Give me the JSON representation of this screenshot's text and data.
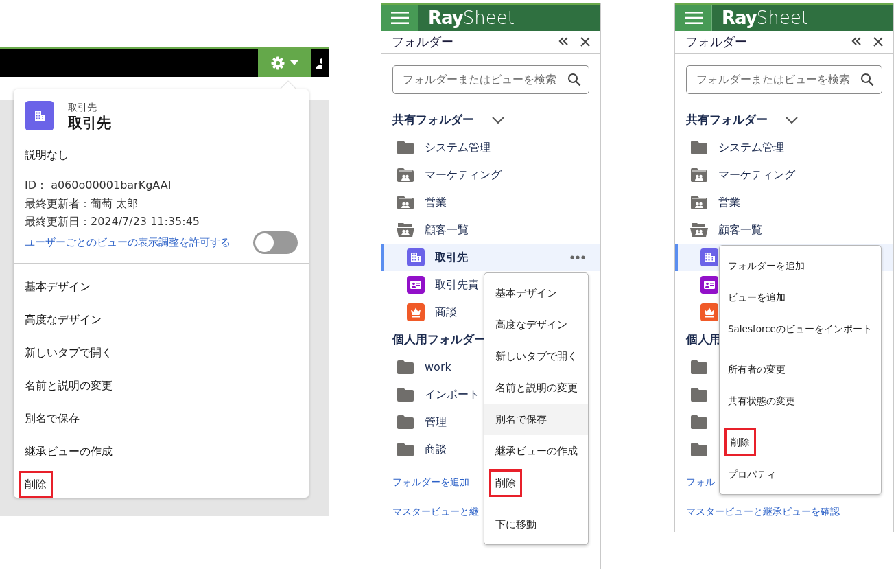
{
  "panel_1": {
    "popover": {
      "object_type": "取引先",
      "title": "取引先",
      "description": "説明なし",
      "details": [
        "ID： a060o00001barKgAAI",
        "最終更新者：葡萄 太郎",
        "最終更新日：2024/7/23 11:35:45"
      ],
      "toggle": {
        "label": "ユーザーごとのビューの表示調整を許可する",
        "on": false
      },
      "menu": [
        [
          {
            "label": "基本デザイン",
            "highlighted": false,
            "hovered": false
          },
          {
            "label": "高度なデザイン",
            "highlighted": false,
            "hovered": false
          },
          {
            "label": "新しいタブで開く",
            "highlighted": false,
            "hovered": false
          },
          {
            "label": "名前と説明の変更",
            "highlighted": false,
            "hovered": false
          },
          {
            "label": "別名で保存",
            "highlighted": false,
            "hovered": false
          },
          {
            "label": "継承ビューの作成",
            "highlighted": false,
            "hovered": false
          },
          {
            "label": "削除",
            "highlighted": true,
            "hovered": false
          }
        ]
      ]
    }
  },
  "panel_2": {
    "logo": {
      "bold": "Ray",
      "light": "Sheet"
    },
    "title": "フォルダー",
    "search": {
      "placeholder": "フォルダーまたはビューを検索"
    },
    "sections": [
      {
        "title": "共有フォルダー",
        "expanded": true,
        "items": [
          {
            "label": "システム管理",
            "kind": "folder",
            "selected": false
          },
          {
            "label": "マーケティング",
            "kind": "shared",
            "selected": false
          },
          {
            "label": "営業",
            "kind": "shared",
            "selected": false
          },
          {
            "label": "顧客一覧",
            "kind": "shared-open",
            "selected": false,
            "children": [
              {
                "label": "取引先",
                "kind": "account",
                "selected": true
              },
              {
                "label": "取引先責",
                "kind": "contact",
                "selected": false
              },
              {
                "label": "商談",
                "kind": "opportunity",
                "selected": false
              }
            ]
          }
        ]
      },
      {
        "title": "個人用フォルダー",
        "items": [
          {
            "label": "work",
            "kind": "folder",
            "selected": false
          },
          {
            "label": "インポート",
            "kind": "folder",
            "selected": false
          },
          {
            "label": "管理",
            "kind": "folder",
            "selected": false
          },
          {
            "label": "商談",
            "kind": "folder",
            "selected": false
          }
        ]
      }
    ],
    "links": [
      "フォルダーを追加",
      "マスタービューと継"
    ],
    "menu": [
      [
        {
          "label": "基本デザイン",
          "highlighted": false,
          "hovered": false
        },
        {
          "label": "高度なデザイン",
          "highlighted": false,
          "hovered": false
        },
        {
          "label": "新しいタブで開く",
          "highlighted": false,
          "hovered": false
        },
        {
          "label": "名前と説明の変更",
          "highlighted": false,
          "hovered": false
        },
        {
          "label": "別名で保存",
          "highlighted": false,
          "hovered": true
        },
        {
          "label": "継承ビューの作成",
          "highlighted": false,
          "hovered": false
        },
        {
          "label": "削除",
          "highlighted": true,
          "hovered": false
        }
      ],
      [
        {
          "label": "下に移動",
          "highlighted": false,
          "hovered": false
        }
      ]
    ]
  },
  "panel_3": {
    "logo": {
      "bold": "Ray",
      "light": "Sheet"
    },
    "title": "フォルダー",
    "search": {
      "placeholder": "フォルダーまたはビューを検索"
    },
    "sections": [
      {
        "title": "共有フォルダー",
        "expanded": true,
        "items": [
          {
            "label": "システム管理",
            "kind": "folder",
            "selected": false
          },
          {
            "label": "マーケティング",
            "kind": "shared",
            "selected": false
          },
          {
            "label": "営業",
            "kind": "shared",
            "selected": false
          },
          {
            "label": "顧客一覧",
            "kind": "shared-open",
            "selected": false,
            "children": [
              {
                "kind": "account",
                "selected": true
              },
              {
                "kind": "contact",
                "selected": false
              },
              {
                "kind": "opportunity",
                "selected": false
              }
            ]
          }
        ]
      },
      {
        "title": "個人用",
        "items": [
          {
            "kind": "folder",
            "selected": false
          },
          {
            "kind": "folder",
            "selected": false
          },
          {
            "kind": "folder",
            "selected": false
          },
          {
            "kind": "folder",
            "selected": false
          }
        ]
      }
    ],
    "links": [
      "フォル",
      "マスタービューと継承ビューを確認"
    ],
    "menu": [
      [
        {
          "label": "フォルダーを追加",
          "highlighted": false,
          "hovered": false
        },
        {
          "label": "ビューを追加",
          "highlighted": false,
          "hovered": false
        },
        {
          "label": "Salesforceのビューをインポート",
          "highlighted": false,
          "hovered": false
        }
      ],
      [
        {
          "label": "所有者の変更",
          "highlighted": false,
          "hovered": false
        },
        {
          "label": "共有状態の変更",
          "highlighted": false,
          "hovered": false
        }
      ],
      [
        {
          "label": "削除",
          "highlighted": true,
          "hovered": false
        },
        {
          "label": "プロパティ",
          "highlighted": false,
          "hovered": false
        }
      ]
    ]
  }
}
